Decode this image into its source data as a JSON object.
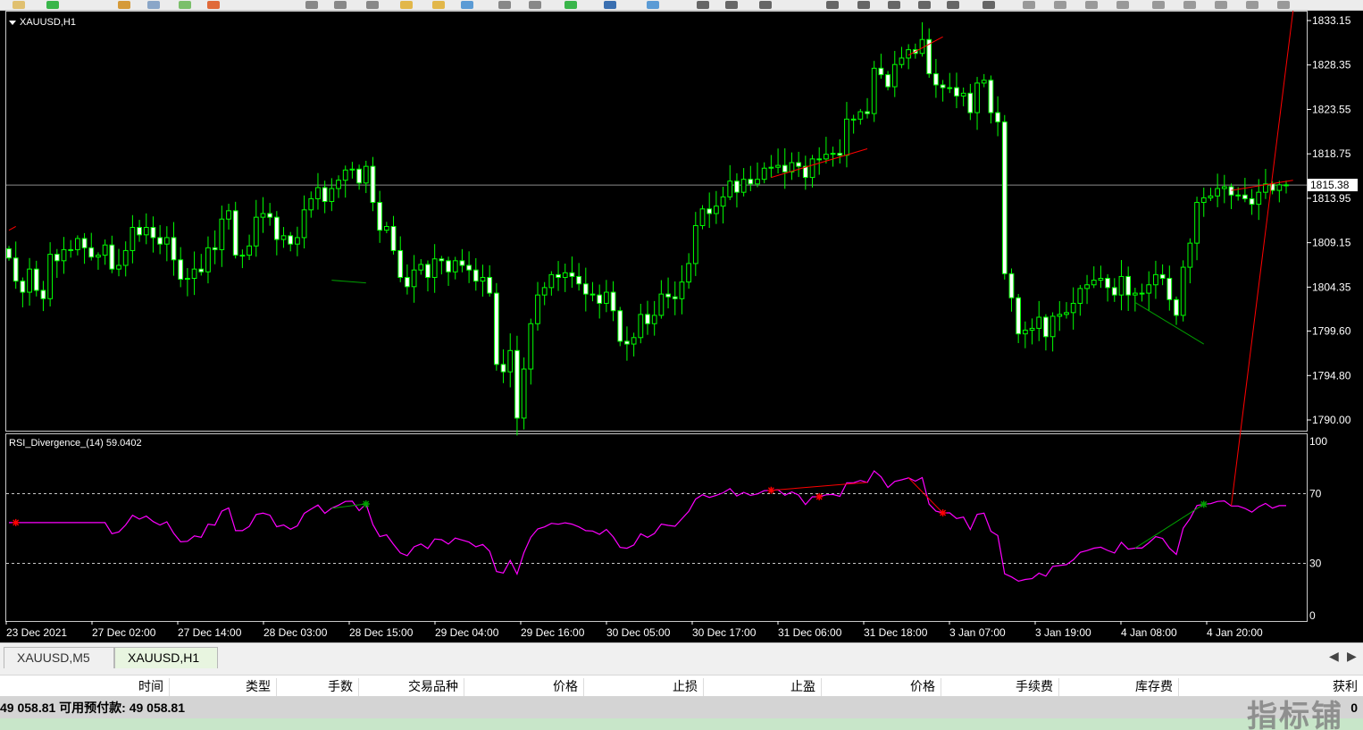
{
  "symbol_title": "XAUUSD,H1",
  "current_price": "1815.38",
  "price_axis_labels": [
    "1833.15",
    "1828.35",
    "1823.55",
    "1818.75",
    "1813.95",
    "1809.15",
    "1804.35",
    "1799.60",
    "1794.80",
    "1790.00"
  ],
  "indicator_title": "RSI_Divergence_(14) 59.0402",
  "rsi_axis_labels": [
    "100",
    "70",
    "30",
    "0"
  ],
  "time_labels": [
    "23 Dec 2021",
    "27 Dec 02:00",
    "27 Dec 14:00",
    "28 Dec 03:00",
    "28 Dec 15:00",
    "29 Dec 04:00",
    "29 Dec 16:00",
    "30 Dec 05:00",
    "30 Dec 17:00",
    "31 Dec 06:00",
    "31 Dec 18:00",
    "3 Jan 07:00",
    "3 Jan 19:00",
    "4 Jan 08:00",
    "4 Jan 20:00"
  ],
  "tabs": [
    {
      "label": "XAUUSD,M5"
    },
    {
      "label": "XAUUSD,H1"
    }
  ],
  "tab_nav": {
    "prev": "◀",
    "next": "▶"
  },
  "columns": [
    "时间",
    "类型",
    "手数",
    "交易品种",
    "价格",
    "止损",
    "止盈",
    "价格",
    "手续费",
    "库存费",
    "获利"
  ],
  "balance_text": "49 058.81  可用预付款: 49 058.81",
  "balance_right": "0",
  "watermark": "指标铺",
  "colors": {
    "bull": "#00ff00",
    "bear_body": "#ffffff",
    "bull_body": "#000000",
    "rsi": "#ff00ff",
    "bear_div": "#ff0000",
    "bull_div": "#00a000"
  },
  "chart_data": {
    "type": "candlestick",
    "symbol": "XAUUSD",
    "timeframe": "H1",
    "ylim": [
      1790.0,
      1833.15
    ],
    "current": 1815.38,
    "closes": [
      1807.5,
      1805.0,
      1803.8,
      1806.3,
      1804.0,
      1803.1,
      1807.9,
      1807.2,
      1808.4,
      1808.4,
      1809.6,
      1808.6,
      1807.6,
      1807.8,
      1808.9,
      1806.3,
      1806.7,
      1808.3,
      1810.8,
      1810.0,
      1810.8,
      1809.7,
      1809.0,
      1809.7,
      1807.3,
      1805.2,
      1805.3,
      1806.3,
      1806.0,
      1808.6,
      1808.4,
      1811.7,
      1812.6,
      1807.8,
      1807.8,
      1808.8,
      1811.9,
      1812.3,
      1811.9,
      1809.5,
      1809.9,
      1809.0,
      1809.7,
      1812.7,
      1813.9,
      1815.1,
      1813.6,
      1815.0,
      1815.9,
      1817.0,
      1817.1,
      1815.6,
      1817.4,
      1813.5,
      1810.5,
      1810.9,
      1808.3,
      1805.4,
      1804.4,
      1806.2,
      1806.8,
      1805.4,
      1807.4,
      1807.2,
      1806.0,
      1807.2,
      1806.7,
      1806.2,
      1805.0,
      1805.4,
      1803.7,
      1796.0,
      1795.2,
      1797.5,
      1790.2,
      1795.5,
      1800.4,
      1803.5,
      1804.3,
      1805.7,
      1805.4,
      1805.9,
      1805.5,
      1804.7,
      1803.6,
      1803.5,
      1802.6,
      1803.8,
      1801.8,
      1798.5,
      1798.2,
      1798.9,
      1801.4,
      1800.4,
      1801.3,
      1803.6,
      1803.3,
      1803.1,
      1804.9,
      1806.9,
      1811.0,
      1812.8,
      1812.3,
      1813.1,
      1814.1,
      1815.8,
      1814.6,
      1816.0,
      1815.5,
      1816.0,
      1817.2,
      1817.3,
      1817.5,
      1816.8,
      1817.8,
      1817.4,
      1816.2,
      1818.2,
      1818.2,
      1818.7,
      1818.8,
      1818.6,
      1822.5,
      1822.5,
      1823.3,
      1823.1,
      1828.0,
      1827.3,
      1826.0,
      1828.4,
      1829.1,
      1830.0,
      1829.6,
      1831.1,
      1827.4,
      1826.2,
      1825.9,
      1825.9,
      1825.0,
      1825.3,
      1823.2,
      1826.4,
      1826.7,
      1823.2,
      1822.2,
      1805.8,
      1803.2,
      1799.3,
      1799.7,
      1799.9,
      1801.1,
      1799.0,
      1801.2,
      1801.4,
      1801.6,
      1802.6,
      1804.2,
      1804.6,
      1805.1,
      1805.3,
      1804.3,
      1803.5,
      1805.5,
      1803.5,
      1803.7,
      1803.7,
      1804.6,
      1805.7,
      1805.3,
      1803.0,
      1801.3,
      1806.5,
      1809.1,
      1813.5,
      1814.0,
      1814.2,
      1815.0,
      1815.2,
      1814.3,
      1814.3,
      1813.9,
      1813.3,
      1814.6,
      1815.5,
      1814.8,
      1815.4,
      1815.4
    ]
  },
  "rsi_data": {
    "ylim": [
      0,
      100
    ],
    "levels": [
      70,
      30
    ],
    "current": 59.0402
  }
}
